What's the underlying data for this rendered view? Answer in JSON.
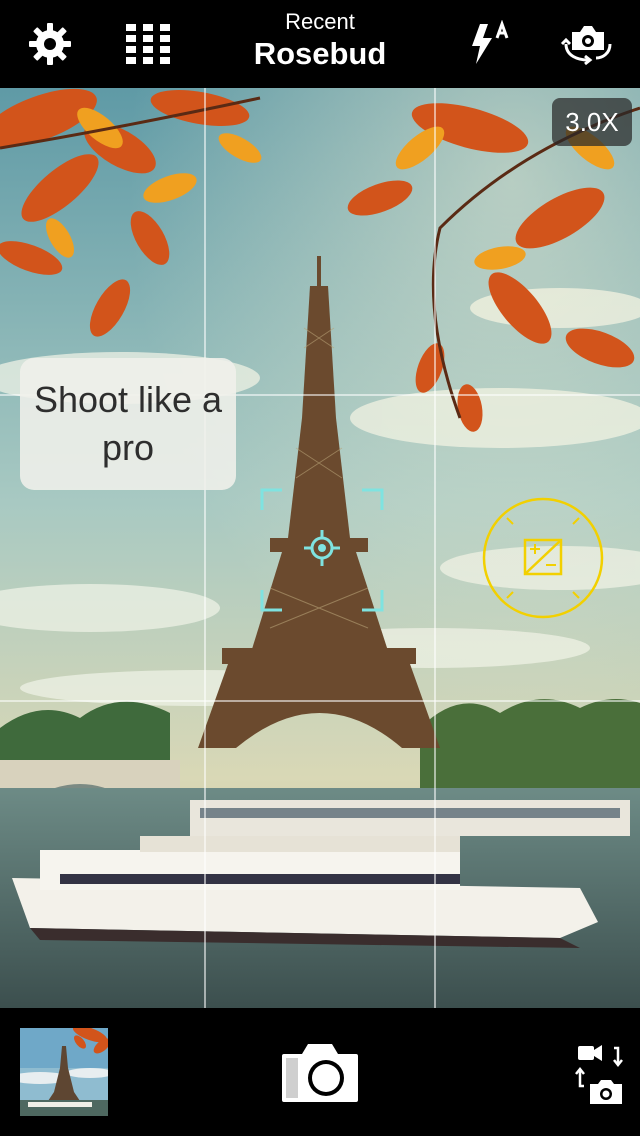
{
  "header": {
    "filter_label": "Recent",
    "filter_name": "Rosebud"
  },
  "viewfinder": {
    "zoom": "3.0X",
    "tooltip": "Shoot like a pro"
  },
  "icons": {
    "settings": "gear-icon",
    "grid": "grid-icon",
    "flash": "flash-auto-icon",
    "switch_camera": "switch-camera-icon",
    "focus": "focus-reticle-icon",
    "exposure": "exposure-icon",
    "shutter": "camera-icon",
    "mode": "photo-video-toggle-icon"
  },
  "colors": {
    "focus_reticle": "#7fe3e0",
    "exposure_ring": "#f2d000",
    "bars": "#000000"
  }
}
